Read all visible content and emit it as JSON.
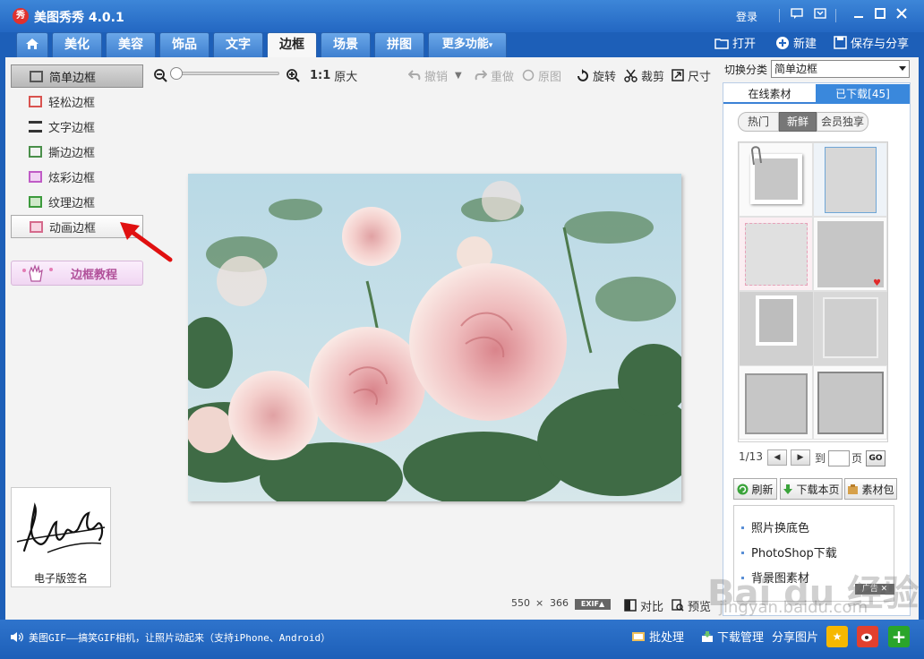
{
  "window": {
    "app_title": "美图秀秀 4.0.1",
    "login": "登录",
    "logo_char": "秀"
  },
  "tabs": [
    {
      "label": "美化"
    },
    {
      "label": "美容"
    },
    {
      "label": "饰品"
    },
    {
      "label": "文字"
    },
    {
      "label": "边框"
    },
    {
      "label": "场景"
    },
    {
      "label": "拼图"
    },
    {
      "label": "更多功能"
    }
  ],
  "top_actions": {
    "open": "打开",
    "new": "新建",
    "save_share": "保存与分享"
  },
  "left_panel": {
    "items": [
      {
        "label": "简单边框"
      },
      {
        "label": "轻松边框"
      },
      {
        "label": "文字边框"
      },
      {
        "label": "撕边边框"
      },
      {
        "label": "炫彩边框"
      },
      {
        "label": "纹理边框"
      },
      {
        "label": "动画边框"
      }
    ],
    "tutorial": "边框教程",
    "signature_label": "电子版签名"
  },
  "toolbar": {
    "zoom_original": "1:1",
    "original_size": "原大",
    "undo": "撤销",
    "redo": "重做",
    "original": "原图",
    "rotate": "旋转",
    "crop": "裁剪",
    "size": "尺寸"
  },
  "canvas": {
    "width_value": "550",
    "times": "×",
    "height_value": "366",
    "exif": "EXIF▲",
    "compare": "对比",
    "preview": "预览"
  },
  "right_panel": {
    "switch_label": "切换分类",
    "category": "简单边框",
    "tab_online": "在线素材",
    "tab_downloaded": "已下载[45]",
    "subtabs": [
      {
        "label": "热门"
      },
      {
        "label": "新鲜"
      },
      {
        "label": "会员独享"
      }
    ],
    "pager": {
      "page": "1/13",
      "to": "到",
      "page_unit": "页",
      "go": "GO"
    },
    "actions": {
      "refresh": "刷新",
      "download_page": "下载本页",
      "package": "素材包"
    },
    "ad_links": [
      {
        "label": "照片换底色"
      },
      {
        "label": "PhotoShop下载"
      },
      {
        "label": "背景图素材"
      }
    ],
    "ad_tag": "广告"
  },
  "status_bar": {
    "message": "美图GIF——搞笑GIF相机，让照片动起来（支持iPhone、Android）",
    "batch": "批处理",
    "download_manager": "下载管理",
    "share_picture": "分享图片"
  },
  "watermark": {
    "text": "Bai du 经验",
    "url": "jingyan.baidu.com"
  },
  "colors": {
    "title_bar": "#2367c2",
    "tab_active_bg": "#f7f7f7",
    "red_arrow": "#e01010",
    "tutorial_text": "#b1509a"
  }
}
